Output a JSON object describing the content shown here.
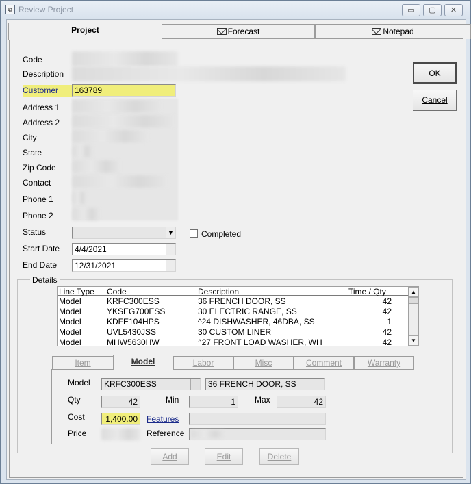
{
  "window": {
    "title": "Review Project",
    "controls": {
      "minimize": "▭",
      "maximize": "▢",
      "close": "✕"
    }
  },
  "tabs": [
    {
      "label": "Project",
      "active": true
    },
    {
      "label": "Forecast",
      "icon": "envelope-icon"
    },
    {
      "label": "Notepad",
      "icon": "envelope-icon"
    }
  ],
  "form": {
    "labels": {
      "code": "Code",
      "description": "Description",
      "customer": "Customer",
      "address1": "Address 1",
      "address2": "Address 2",
      "city": "City",
      "state": "State",
      "zip": "Zip Code",
      "contact": "Contact",
      "phone1": "Phone 1",
      "phone2": "Phone 2",
      "status": "Status",
      "start_date": "Start Date",
      "end_date": "End Date",
      "completed": "Completed"
    },
    "customer": "163789",
    "status": "",
    "start_date": "4/4/2021",
    "end_date": "12/31/2021",
    "completed": false
  },
  "buttons": {
    "ok": "OK",
    "cancel": "Cancel"
  },
  "details": {
    "title": "Details",
    "columns": [
      "Line Type",
      "Code",
      "Description",
      "Time  /  Qty"
    ],
    "rows": [
      {
        "type": "Model",
        "code": "KRFC300ESS",
        "description": "36 FRENCH DOOR, SS",
        "qty": "42"
      },
      {
        "type": "Model",
        "code": "YKSEG700ESS",
        "description": "30 ELECTRIC RANGE, SS",
        "qty": "42"
      },
      {
        "type": "Model",
        "code": "KDFE104HPS",
        "description": "^24 DISHWASHER, 46DBA, SS",
        "qty": "1"
      },
      {
        "type": "Model",
        "code": "UVL5430JSS",
        "description": "30  CUSTOM LINER",
        "qty": "42"
      },
      {
        "type": "Model",
        "code": "MHW5630HW",
        "description": "^27 FRONT LOAD WASHER, WH",
        "qty": "42"
      }
    ],
    "subtabs": [
      "Item",
      "Model",
      "Labor",
      "Misc",
      "Comment",
      "Warranty"
    ],
    "active_subtab": "Model",
    "model": {
      "labels": {
        "model": "Model",
        "qty": "Qty",
        "min": "Min",
        "max": "Max",
        "cost": "Cost",
        "features": "Features",
        "price": "Price",
        "reference": "Reference"
      },
      "code": "KRFC300ESS",
      "description": "36 FRENCH DOOR, SS",
      "qty": "42",
      "min": "1",
      "max": "42",
      "cost": "1,400.00"
    },
    "actions": {
      "add": "Add",
      "edit": "Edit",
      "delete": "Delete"
    }
  },
  "colors": {
    "highlight": "#f0ee7b",
    "window_frame": "#dbe4ee",
    "face": "#f0f0f0"
  }
}
